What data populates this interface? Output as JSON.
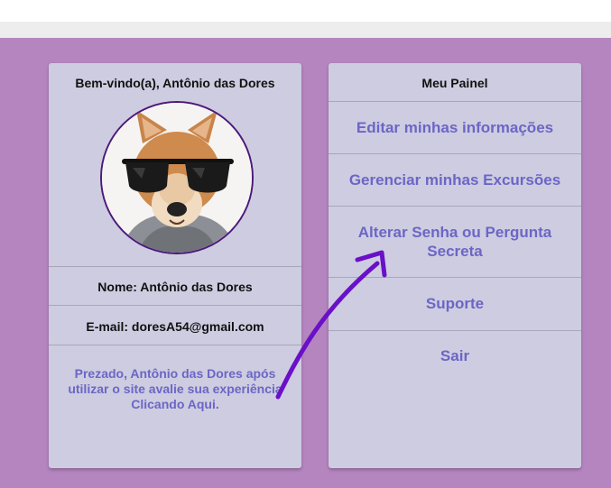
{
  "profile": {
    "welcome": "Bem-vindo(a), Antônio das Dores",
    "name": "Nome: Antônio das Dores",
    "email": "E-mail: doresA54@gmail.com",
    "feedback": "Prezado, Antônio das Dores após utilizar o site avalie sua experiência Clicando Aqui."
  },
  "panel": {
    "title": "Meu Painel",
    "items": [
      {
        "label": "Editar minhas informações"
      },
      {
        "label": "Gerenciar minhas Excursões"
      },
      {
        "label": "Alterar Senha ou Pergunta Secreta"
      },
      {
        "label": "Suporte"
      },
      {
        "label": "Sair"
      }
    ]
  },
  "colors": {
    "page_background": "#b585c0",
    "card_background": "#cecce0",
    "link_color": "#6b66c6",
    "annotation_arrow": "#6a10c8"
  }
}
